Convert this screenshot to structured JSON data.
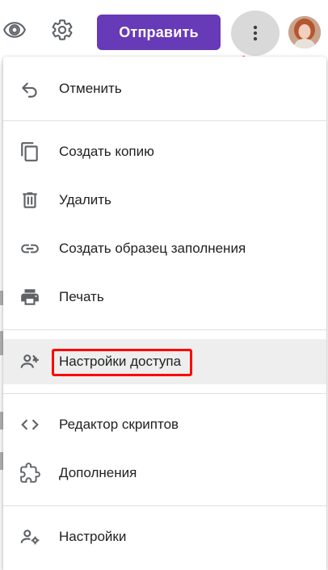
{
  "toolbar": {
    "preview_icon": "eye-icon",
    "settings_icon": "gear-icon",
    "send_label": "Отправить",
    "more_icon": "more-vertical-icon",
    "avatar_icon": "user-avatar",
    "accent_color": "#673ab7"
  },
  "menu": {
    "items": [
      {
        "label": "Отменить",
        "icon": "undo-icon"
      },
      {
        "label": "Создать копию",
        "icon": "copy-icon"
      },
      {
        "label": "Удалить",
        "icon": "trash-icon"
      },
      {
        "label": "Создать образец заполнения",
        "icon": "link-icon"
      },
      {
        "label": "Печать",
        "icon": "print-icon"
      },
      {
        "label": "Настройки доступа",
        "icon": "add-collaborator-icon",
        "highlighted": true
      },
      {
        "label": "Редактор скриптов",
        "icon": "code-icon"
      },
      {
        "label": "Дополнения",
        "icon": "puzzle-icon"
      },
      {
        "label": "Настройки",
        "icon": "user-settings-icon"
      }
    ]
  },
  "annotation": {
    "arrow_color": "#e0001a",
    "box_color": "#ff0000"
  }
}
